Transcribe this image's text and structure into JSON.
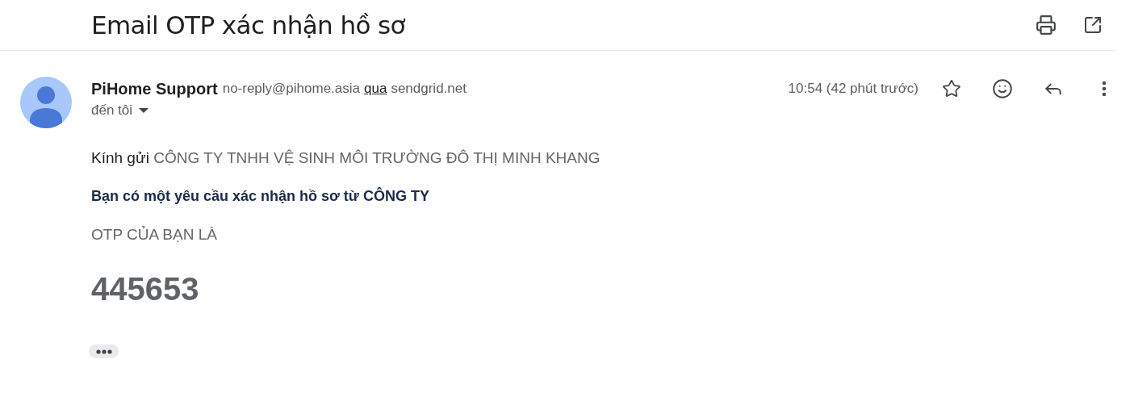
{
  "subject": "Email OTP xác nhận hồ sơ",
  "sender": {
    "name": "PiHome Support",
    "email": "no-reply@pihome.asia",
    "via_label": "qua",
    "via_domain": "sendgrid.net",
    "recipient": "đến tôi",
    "time": "10:54 (42 phút trước)"
  },
  "body": {
    "greeting": "Kính gửi",
    "recipient_name": "CÔNG TY TNHH VỆ SINH MÔI TRƯỜNG ĐÔ THỊ MINH KHANG",
    "request": "Bạn có một yêu cầu xác nhận hồ sơ từ CÔNG TY",
    "otp_label": "OTP CỦA BẠN LÀ",
    "otp_code": "445653"
  }
}
